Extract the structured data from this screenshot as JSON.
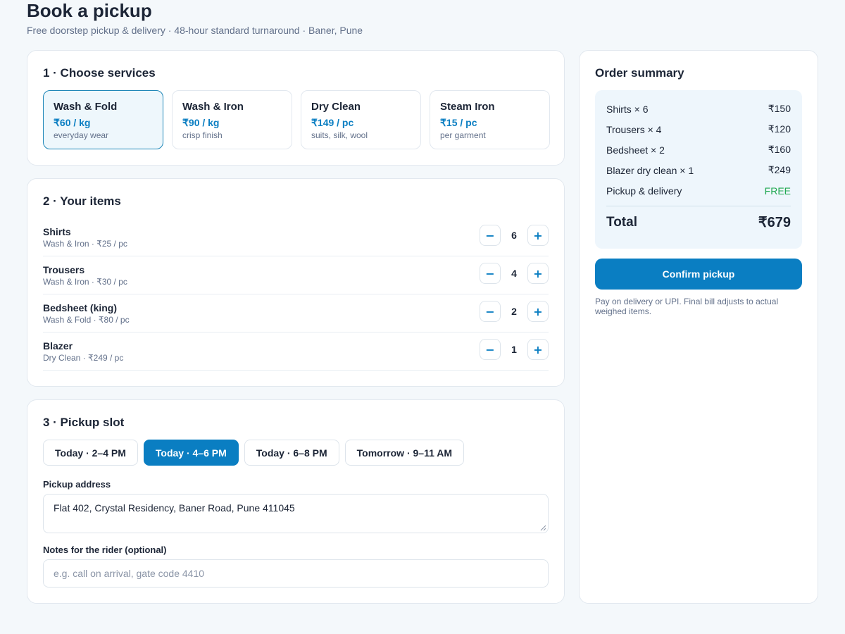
{
  "header": {
    "title": "Book a pickup",
    "subtitle": "Free doorstep pickup & delivery · 48-hour standard turnaround · Baner, Pune"
  },
  "services": {
    "title": "1 · Choose services",
    "selected": "Wash & Fold",
    "options": [
      {
        "name": "Wash & Fold",
        "price": "₹60 / kg",
        "desc": "everyday wear"
      },
      {
        "name": "Wash & Iron",
        "price": "₹90 / kg",
        "desc": "crisp finish"
      },
      {
        "name": "Dry Clean",
        "price": "₹149 / pc",
        "desc": "suits, silk, wool"
      },
      {
        "name": "Steam Iron",
        "price": "₹15 / pc",
        "desc": "per garment"
      }
    ]
  },
  "items": {
    "title": "2 · Your items",
    "minus": "−",
    "plus": "+",
    "rows": [
      {
        "name": "Shirts",
        "meta": "Wash & Iron · ₹25 / pc",
        "qty": "6"
      },
      {
        "name": "Trousers",
        "meta": "Wash & Iron · ₹30 / pc",
        "qty": "4"
      },
      {
        "name": "Bedsheet (king)",
        "meta": "Wash & Fold · ₹80 / pc",
        "qty": "2"
      },
      {
        "name": "Blazer",
        "meta": "Dry Clean · ₹249 / pc",
        "qty": "1"
      }
    ]
  },
  "slot": {
    "title": "3 · Pickup slot",
    "selected": "Today · 4–6 PM",
    "options": [
      "Today · 2–4 PM",
      "Today · 4–6 PM",
      "Today · 6–8 PM",
      "Tomorrow · 9–11 AM"
    ],
    "address_label": "Pickup address",
    "address_value": "Flat 402, Crystal Residency, Baner Road, Pune 411045",
    "notes_label": "Notes for the rider (optional)",
    "notes_placeholder": "e.g. call on arrival, gate code 4410",
    "notes_value": ""
  },
  "summary": {
    "title": "Order summary",
    "lines": [
      {
        "label": "Shirts × 6",
        "value": "₹150"
      },
      {
        "label": "Trousers × 4",
        "value": "₹120"
      },
      {
        "label": "Bedsheet × 2",
        "value": "₹160"
      },
      {
        "label": "Blazer dry clean × 1",
        "value": "₹249"
      },
      {
        "label": "Pickup & delivery",
        "value": "FREE"
      }
    ],
    "total_label": "Total",
    "total_value": "₹679",
    "confirm_label": "Confirm pickup",
    "note": "Pay on delivery or UPI. Final bill adjusts to actual weighed items."
  },
  "colors": {
    "accent": "#0a7ec2",
    "free": "#1fa84f",
    "background": "#f4f8fb"
  }
}
